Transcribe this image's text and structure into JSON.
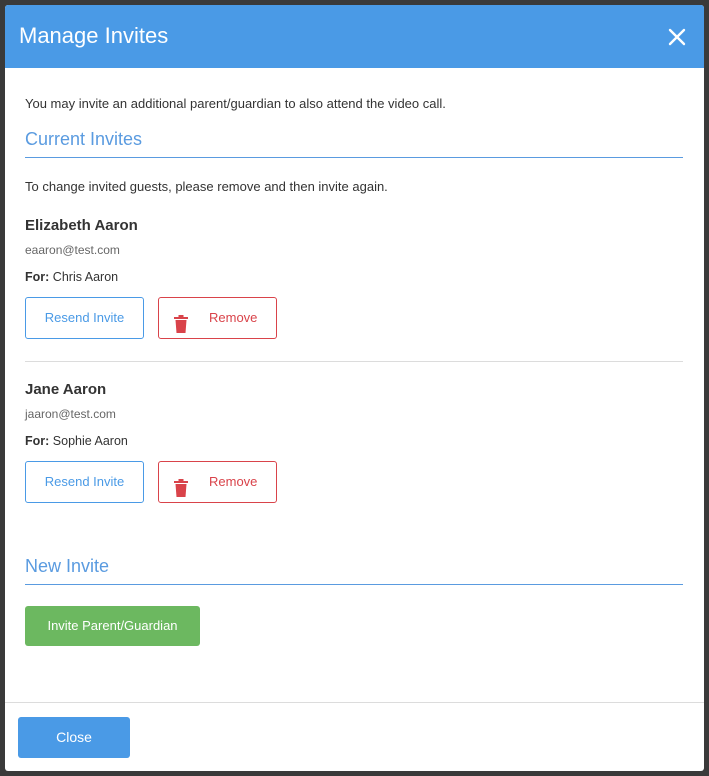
{
  "header": {
    "title": "Manage Invites",
    "close_icon": "close-icon"
  },
  "intro_text": "You may invite an additional parent/guardian to also attend the video call.",
  "current": {
    "title": "Current Invites",
    "note": "To change invited guests, please remove and then invite again.",
    "invites": [
      {
        "name": "Elizabeth Aaron",
        "email": "eaaron@test.com",
        "for_label": "For:",
        "for_value": "Chris Aaron",
        "resend_label": "Resend Invite",
        "remove_label": "Remove"
      },
      {
        "name": "Jane Aaron",
        "email": "jaaron@test.com",
        "for_label": "For:",
        "for_value": "Sophie Aaron",
        "resend_label": "Resend Invite",
        "remove_label": "Remove"
      }
    ]
  },
  "new_invite": {
    "title": "New Invite",
    "button_label": "Invite Parent/Guardian"
  },
  "footer": {
    "close_label": "Close"
  },
  "colors": {
    "primary": "#4a9ae6",
    "danger": "#d9434a",
    "success": "#6cb860"
  }
}
